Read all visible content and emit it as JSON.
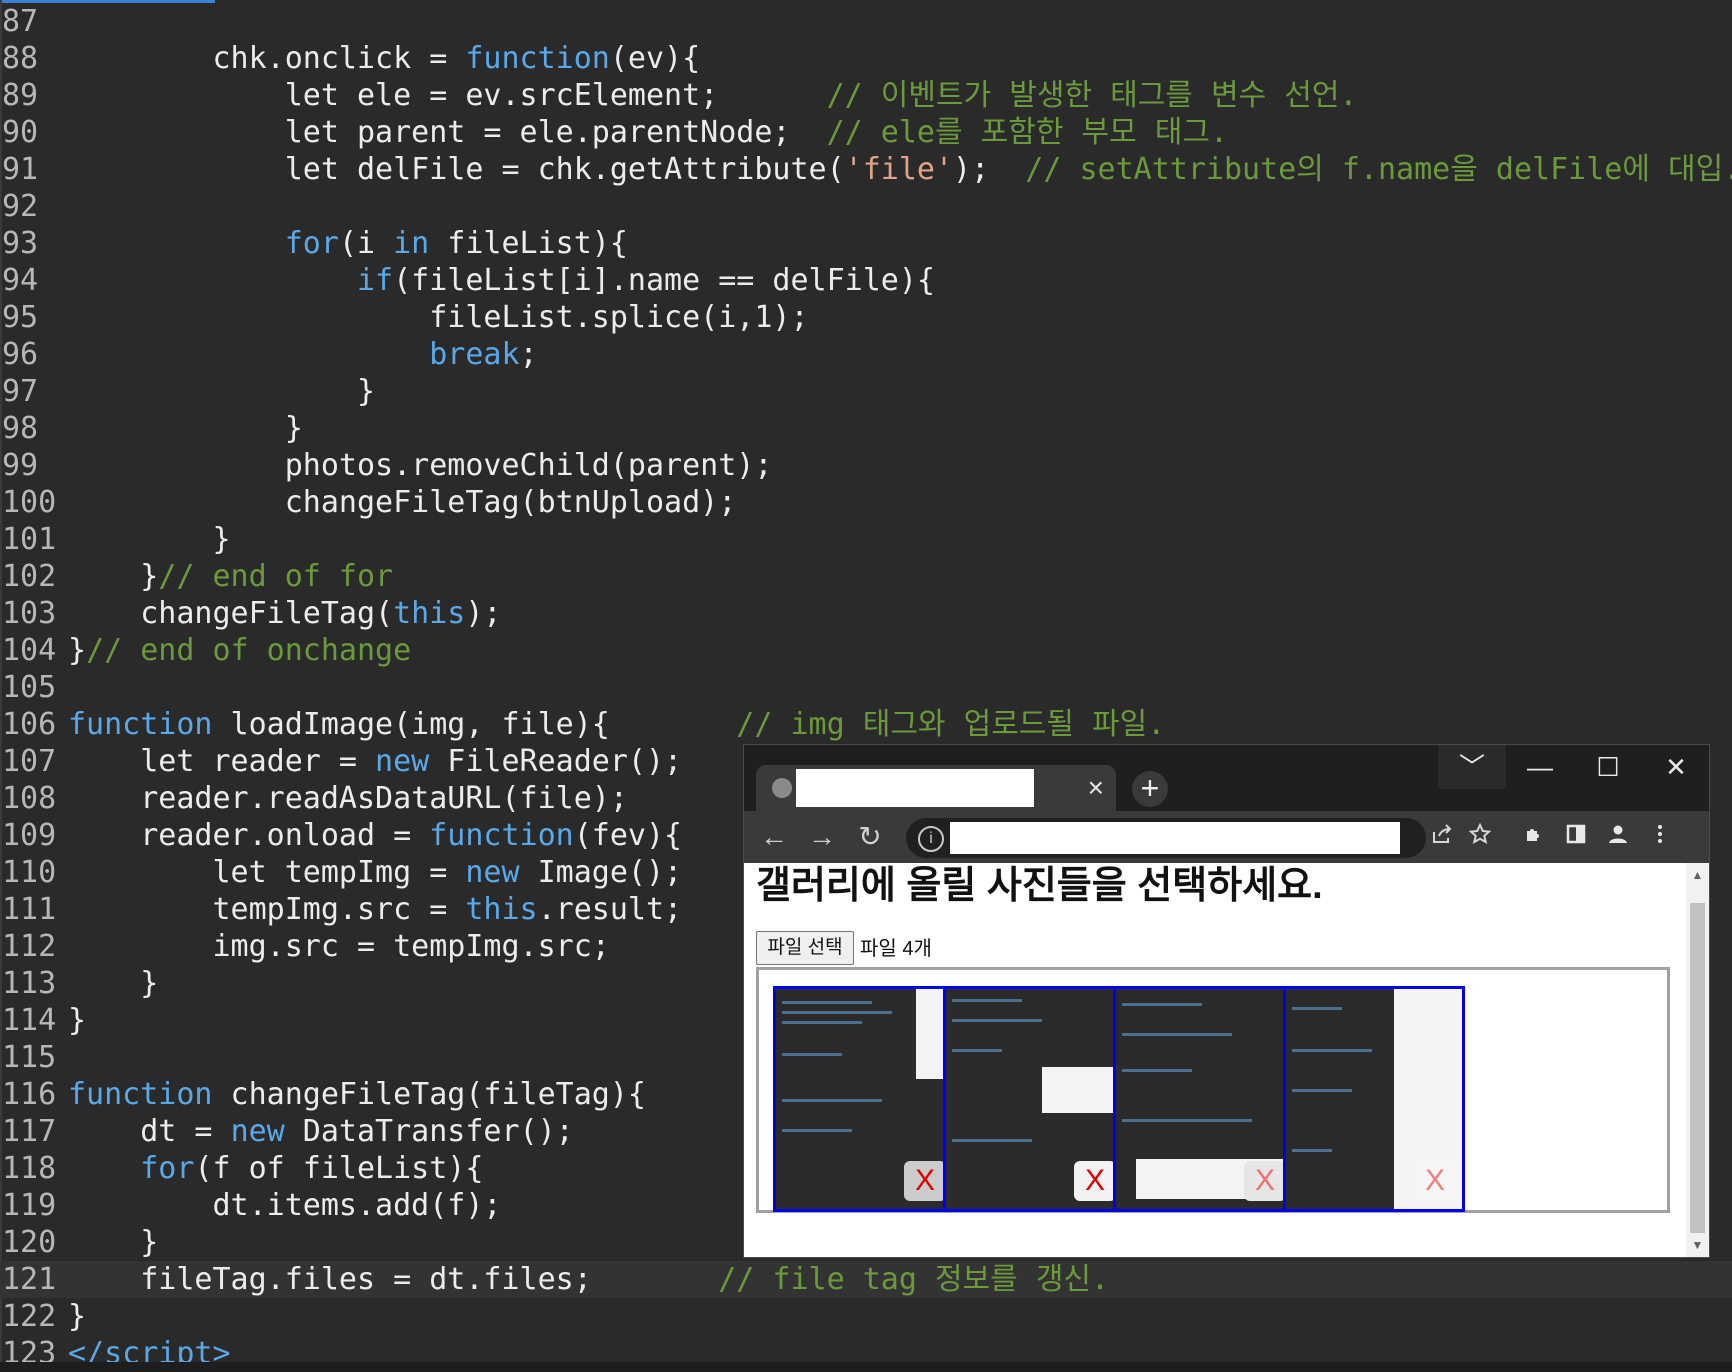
{
  "editor": {
    "lines": [
      {
        "n": "87",
        "tokens": []
      },
      {
        "n": "88",
        "tokens": [
          {
            "t": "        chk.onclick = "
          },
          {
            "t": "function",
            "c": "k"
          },
          {
            "t": "(ev){"
          }
        ]
      },
      {
        "n": "89",
        "tokens": [
          {
            "t": "            let ele = ev.srcElement;      "
          },
          {
            "t": "// 이벤트가 발생한 태그를 변수 선언.",
            "c": "c"
          }
        ]
      },
      {
        "n": "90",
        "tokens": [
          {
            "t": "            let parent = ele.parentNode;  "
          },
          {
            "t": "// ele를 포함한 부모 태그.",
            "c": "c"
          }
        ]
      },
      {
        "n": "91",
        "tokens": [
          {
            "t": "            let delFile = chk.getAttribute("
          },
          {
            "t": "'file'",
            "c": "s"
          },
          {
            "t": ");  "
          },
          {
            "t": "// setAttribute의 f.name을 delFile에 대입.",
            "c": "c"
          }
        ]
      },
      {
        "n": "92",
        "tokens": []
      },
      {
        "n": "93",
        "tokens": [
          {
            "t": "            "
          },
          {
            "t": "for",
            "c": "k"
          },
          {
            "t": "(i "
          },
          {
            "t": "in",
            "c": "k"
          },
          {
            "t": " fileList){"
          }
        ]
      },
      {
        "n": "94",
        "tokens": [
          {
            "t": "                "
          },
          {
            "t": "if",
            "c": "k"
          },
          {
            "t": "(fileList[i].name == delFile){"
          }
        ]
      },
      {
        "n": "95",
        "tokens": [
          {
            "t": "                    fileList.splice(i,1);"
          }
        ]
      },
      {
        "n": "96",
        "tokens": [
          {
            "t": "                    "
          },
          {
            "t": "break",
            "c": "k"
          },
          {
            "t": ";"
          }
        ]
      },
      {
        "n": "97",
        "tokens": [
          {
            "t": "                }"
          }
        ]
      },
      {
        "n": "98",
        "tokens": [
          {
            "t": "            }"
          }
        ]
      },
      {
        "n": "99",
        "tokens": [
          {
            "t": "            photos.removeChild(parent);"
          }
        ]
      },
      {
        "n": "100",
        "tokens": [
          {
            "t": "            changeFileTag(btnUpload);"
          }
        ]
      },
      {
        "n": "101",
        "tokens": [
          {
            "t": "        }"
          }
        ]
      },
      {
        "n": "102",
        "tokens": [
          {
            "t": "    }"
          },
          {
            "t": "// end of for",
            "c": "c"
          }
        ]
      },
      {
        "n": "103",
        "tokens": [
          {
            "t": "    changeFileTag("
          },
          {
            "t": "this",
            "c": "k"
          },
          {
            "t": ");"
          }
        ]
      },
      {
        "n": "104",
        "tokens": [
          {
            "t": "}"
          },
          {
            "t": "// end of onchange",
            "c": "c"
          }
        ]
      },
      {
        "n": "105",
        "tokens": []
      },
      {
        "n": "106",
        "tokens": [
          {
            "t": "function",
            "c": "k"
          },
          {
            "t": " loadImage(img, file){       "
          },
          {
            "t": "// img 태그와 업로드될 파일.",
            "c": "c"
          }
        ]
      },
      {
        "n": "107",
        "tokens": [
          {
            "t": "    let reader = "
          },
          {
            "t": "new",
            "c": "k"
          },
          {
            "t": " FileReader();"
          }
        ]
      },
      {
        "n": "108",
        "tokens": [
          {
            "t": "    reader.readAsDataURL(file);"
          }
        ]
      },
      {
        "n": "109",
        "tokens": [
          {
            "t": "    reader.onload = "
          },
          {
            "t": "function",
            "c": "k"
          },
          {
            "t": "(fev){"
          }
        ]
      },
      {
        "n": "110",
        "tokens": [
          {
            "t": "        let tempImg = "
          },
          {
            "t": "new",
            "c": "k"
          },
          {
            "t": " Image();"
          }
        ]
      },
      {
        "n": "111",
        "tokens": [
          {
            "t": "        tempImg.src = "
          },
          {
            "t": "this",
            "c": "k"
          },
          {
            "t": ".result;"
          }
        ]
      },
      {
        "n": "112",
        "tokens": [
          {
            "t": "        img.src = tempImg.src;"
          }
        ]
      },
      {
        "n": "113",
        "tokens": [
          {
            "t": "    }"
          }
        ]
      },
      {
        "n": "114",
        "tokens": [
          {
            "t": "}"
          }
        ]
      },
      {
        "n": "115",
        "tokens": []
      },
      {
        "n": "116",
        "tokens": [
          {
            "t": "function",
            "c": "k"
          },
          {
            "t": " changeFileTag(fileTag){"
          }
        ]
      },
      {
        "n": "117",
        "tokens": [
          {
            "t": "    dt = "
          },
          {
            "t": "new",
            "c": "k"
          },
          {
            "t": " DataTransfer();"
          }
        ]
      },
      {
        "n": "118",
        "tokens": [
          {
            "t": "    "
          },
          {
            "t": "for",
            "c": "k"
          },
          {
            "t": "(f of fileList){"
          }
        ]
      },
      {
        "n": "119",
        "tokens": [
          {
            "t": "        dt.items.add(f);"
          }
        ]
      },
      {
        "n": "120",
        "tokens": [
          {
            "t": "    }"
          }
        ]
      },
      {
        "n": "121",
        "tokens": [
          {
            "t": "    fileTag.files = dt.files;       "
          },
          {
            "t": "// file tag 정보를 갱신.",
            "c": "c"
          }
        ],
        "highlight": true
      },
      {
        "n": "122",
        "tokens": [
          {
            "t": "}"
          }
        ]
      },
      {
        "n": "123",
        "tokens": [
          {
            "t": "</",
            "c": "k"
          },
          {
            "t": "script",
            "c": "tg"
          },
          {
            "t": ">",
            "c": "k"
          }
        ]
      }
    ]
  },
  "browser": {
    "tab_close": "×",
    "new_tab": "+",
    "window": {
      "chevron": "﹀",
      "minimize": "—",
      "maximize": "☐",
      "close": "✕"
    },
    "nav": {
      "back": "←",
      "forward": "→",
      "reload": "↻"
    },
    "omnibox_info": "i",
    "page": {
      "heading": "갤러리에 올릴 사진들을 선택하세요.",
      "file_button": "파일 선택",
      "file_count": "파일 4개",
      "photos": [
        {
          "remove_label": "X"
        },
        {
          "remove_label": "X"
        },
        {
          "remove_label": "X"
        },
        {
          "remove_label": "X"
        }
      ]
    }
  },
  "colors": {
    "keyword": "#5aa8e8",
    "comment": "#6a9a3c",
    "string": "#e0a38a",
    "photo_border": "#0000ee",
    "remove_x": "#e00000"
  }
}
